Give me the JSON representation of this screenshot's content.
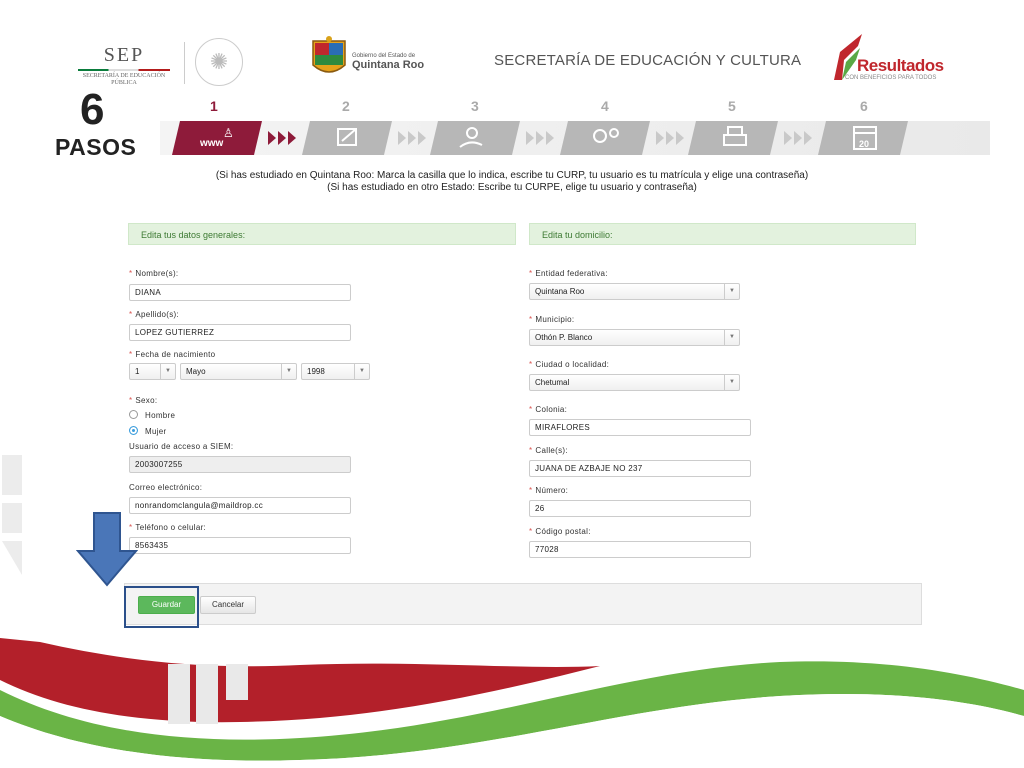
{
  "header": {
    "sep_title": "SEP",
    "sep_subtitle": "SECRETARÍA DE EDUCACIÓN PÚBLICA",
    "qroo_line1": "Gobierno del Estado de",
    "qroo_line2": "Quintana Roo",
    "secretaria": "SECRETARÍA DE EDUCACIÓN Y CULTURA",
    "resultados_title": "Resultados",
    "resultados_sub": "CON BENEFICIOS PARA TODOS"
  },
  "steps": {
    "big_number": "6",
    "word": "PASOS",
    "items": [
      {
        "num": "1",
        "label": "www",
        "icon": "www-person-icon",
        "active": true
      },
      {
        "num": "2",
        "label": "",
        "icon": "form-pencil-icon",
        "active": false
      },
      {
        "num": "3",
        "label": "",
        "icon": "hand-coin-icon",
        "active": false
      },
      {
        "num": "4",
        "label": "",
        "icon": "gears-cursor-icon",
        "active": false
      },
      {
        "num": "5",
        "label": "",
        "icon": "printer-icon",
        "active": false
      },
      {
        "num": "6",
        "label": "20",
        "icon": "calendar-icon",
        "active": false
      }
    ]
  },
  "instructions": {
    "line1": "(Si has estudiado en Quintana Roo: Marca la casilla que lo indica, escribe tu CURP,  tu usuario es tu matrícula y elige una contraseña)",
    "line2": "(Si has estudiado en otro Estado: Escribe tu CURPE, elige tu usuario y contraseña)"
  },
  "left": {
    "header": "Edita tus datos generales:",
    "nombre_label": "Nombre(s):",
    "nombre_value": "DIANA",
    "apellido_label": "Apellido(s):",
    "apellido_value": "LOPEZ GUTIERREZ",
    "fecha_label": "Fecha de nacimiento",
    "dia": "1",
    "mes": "Mayo",
    "anio": "1998",
    "sexo_label": "Sexo:",
    "hombre": "Hombre",
    "mujer": "Mujer",
    "usuario_label": "Usuario de acceso a SIEM:",
    "usuario_value": "2003007255",
    "correo_label": "Correo electrónico:",
    "correo_value": "nonrandomclangula@maildrop.cc",
    "telefono_label": "Teléfono o celular:",
    "telefono_value": "8563435"
  },
  "right": {
    "header": "Edita tu domicilio:",
    "entidad_label": "Entidad federativa:",
    "entidad_value": "Quintana Roo",
    "municipio_label": "Municipio:",
    "municipio_value": "Othón P. Blanco",
    "ciudad_label": "Ciudad o localidad:",
    "ciudad_value": "Chetumal",
    "colonia_label": "Colonia:",
    "colonia_value": "MIRAFLORES",
    "calle_label": "Calle(s):",
    "calle_value": "JUANA DE AZBAJE NO 237",
    "numero_label": "Número:",
    "numero_value": "26",
    "cp_label": "Código postal:",
    "cp_value": "77028"
  },
  "actions": {
    "save": "Guardar",
    "cancel": "Cancelar"
  },
  "colors": {
    "active_step": "#8e1b3a",
    "save_green": "#5cb85c",
    "arrow_blue": "#4a76b8",
    "wave_red": "#b3202a",
    "wave_green": "#6ab446"
  }
}
